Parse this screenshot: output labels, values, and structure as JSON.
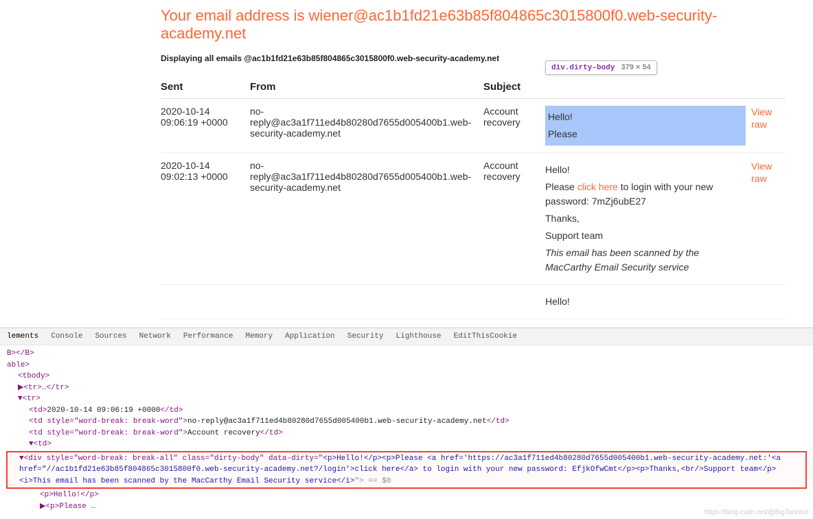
{
  "header": {
    "prefix": "Your email address is ",
    "email": "wiener@ac1b1fd21e63b85f804865c3015800f0.web-security-academy.net"
  },
  "displaying_note": "Displaying all emails @ac1b1fd21e63b85f804865c3015800f0.web-security-academy.net",
  "columns": {
    "sent": "Sent",
    "from": "From",
    "subject": "Subject",
    "action": "View raw"
  },
  "tooltip": {
    "selector": "div.dirty-body",
    "dims": "379 × 54"
  },
  "rows": [
    {
      "sent": "2020-10-14 09:06:19 +0000",
      "from": "no-reply@ac3a1f711ed4b80280d7655d005400b1.web-security-academy.net",
      "subject": "Account recovery",
      "body_preview": {
        "p1": "Hello!",
        "p2": "Please"
      }
    },
    {
      "sent": "2020-10-14 09:02:13 +0000",
      "from": "no-reply@ac3a1f711ed4b80280d7655d005400b1.web-security-academy.net",
      "subject": "Account recovery",
      "body": {
        "p1": "Hello!",
        "p2a": "Please ",
        "link": "click here",
        "p2b": " to login with your new password: 7mZj6ubE27",
        "p3": "Thanks,",
        "p4": "Support team",
        "p5": "This email has been scanned by the MacCarthy Email Security service"
      }
    },
    {
      "sent": "",
      "from": "",
      "subject": "",
      "body_preview": {
        "p1": "Hello!"
      }
    }
  ],
  "devtools": {
    "tabs": [
      "lements",
      "Console",
      "Sources",
      "Network",
      "Performance",
      "Memory",
      "Application",
      "Security",
      "Lighthouse",
      "EditThisCookie"
    ],
    "lines": {
      "l0": "B></B>",
      "l1": "able>",
      "l2": "<tbody>",
      "l3": "▶<tr>…</tr>",
      "l4": "▼<tr>",
      "l5_open": "<td>",
      "l5_text": "2020-10-14 09:06:19 +0000",
      "l5_close": "</td>",
      "l6_open": "<td style=\"word-break: break-word\">",
      "l6_text": "no-reply@ac3a1f711ed4b80280d7655d005400b1.web-security-academy.net",
      "l6_close": "</td>",
      "l7_open": "<td style=\"word-break: break-word\">",
      "l7_text": "Account recovery",
      "l7_close": "</td>",
      "l8": "▼<td>",
      "sel_a": "▼<div style=\"word-break: break-all\" class=\"dirty-body\" data-dirty=\"",
      "sel_b": "<p>Hello!</p><p>Please <a href='https://ac3a1f711ed4b80280d7655d005400b1.web-security-academy.net:'<a href=\"//ac1b1fd21e63b85f804865c3015800f0.web-security-academy.net?/login'>click here</a> to login with your new password: EfjkOfwCmt</p><p>Thanks,<br/>Support team</p><i>This email has been scanned by the MacCarthy Email Security service</i>",
      "sel_c": "\"> == $0",
      "l10": "<p>Hello!</p>",
      "l11": "▶<p>Please …"
    }
  },
  "watermark": "https://blog.csdn.net/@BigTortoise"
}
